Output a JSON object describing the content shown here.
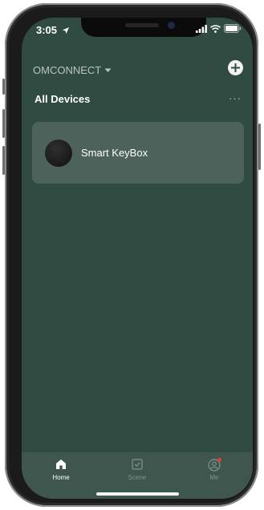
{
  "status_bar": {
    "time": "3:05"
  },
  "header": {
    "home_name": "OMCONNECT"
  },
  "section": {
    "title": "All Devices",
    "more_label": "···"
  },
  "devices": [
    {
      "name": "Smart KeyBox"
    }
  ],
  "tabs": [
    {
      "label": "Home",
      "icon": "home-icon",
      "active": true
    },
    {
      "label": "Scene",
      "icon": "scene-icon",
      "active": false
    },
    {
      "label": "Me",
      "icon": "profile-icon",
      "active": false,
      "notification_dot": true
    }
  ],
  "colors": {
    "background": "#304b42",
    "card": "#4c625a",
    "tabbar": "#3e564e",
    "notification": "#e53935"
  }
}
